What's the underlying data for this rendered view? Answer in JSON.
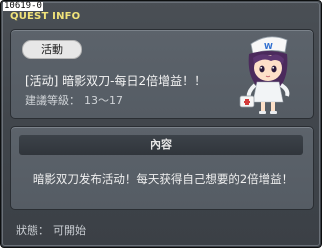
{
  "window": {
    "quest_id": "10619-0",
    "title": "QUEST INFO"
  },
  "quest": {
    "category_badge": "活動",
    "name": "[活动] 暗影双刀-每日2倍增益！！",
    "level_label": "建議等級：",
    "level_range": "13～17"
  },
  "npc": {
    "icon": "nurse-npc-portrait",
    "hat_letter": "W"
  },
  "content": {
    "header": "內容",
    "text": "暗影双刀发布活动！每天获得自己想要的2倍增益！"
  },
  "status": {
    "label": "狀態：",
    "value": "可開始"
  },
  "colors": {
    "title": "#f1e37a",
    "panel": "#5c636b",
    "window": "#434950"
  }
}
